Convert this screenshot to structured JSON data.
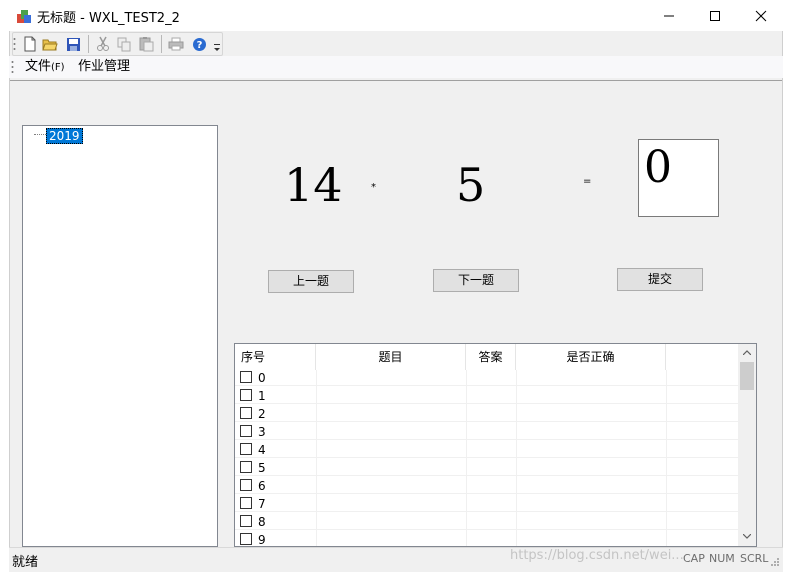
{
  "window": {
    "title": "无标题 - WXL_TEST2_2"
  },
  "menu": {
    "file": "文件",
    "file_mnemonic": "(F)",
    "homework": "作业管理"
  },
  "tree": {
    "root": "2019"
  },
  "question": {
    "operand1": "14",
    "operator": "*",
    "operand2": "5",
    "equals": "=",
    "answer": "0"
  },
  "buttons": {
    "prev": "上一题",
    "next": "下一题",
    "submit": "提交"
  },
  "table": {
    "headers": [
      "序号",
      "题目",
      "答案",
      "是否正确"
    ],
    "rows": [
      "0",
      "1",
      "2",
      "3",
      "4",
      "5",
      "6",
      "7",
      "8",
      "9"
    ]
  },
  "status": {
    "text": "就绪",
    "cap": "CAP",
    "num": "NUM",
    "scrl": "SCRL"
  },
  "watermark": "https://blog.csdn.net/wei..."
}
